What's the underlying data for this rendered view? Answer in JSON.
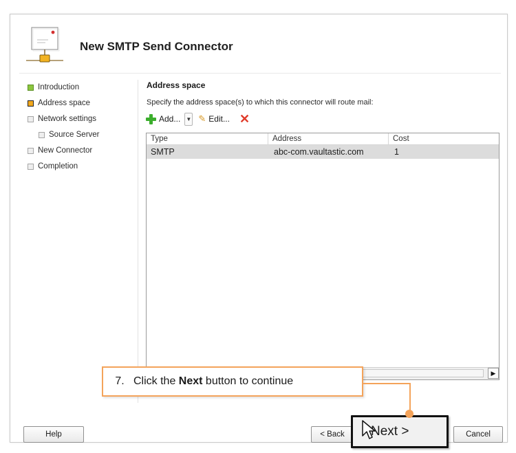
{
  "wizard": {
    "title": "New SMTP Send Connector",
    "icon": "mail-connector-icon"
  },
  "nav": {
    "items": [
      {
        "label": "Introduction",
        "state": "done"
      },
      {
        "label": "Address space",
        "state": "current"
      },
      {
        "label": "Network settings",
        "state": "pending"
      },
      {
        "label": "Source Server",
        "state": "pending",
        "indent": true
      },
      {
        "label": "New Connector",
        "state": "pending"
      },
      {
        "label": "Completion",
        "state": "pending"
      }
    ]
  },
  "main": {
    "section_title": "Address space",
    "description": "Specify the address space(s) to which this connector will route mail:",
    "toolbar": {
      "add_label": "Add...",
      "edit_label": "Edit..."
    },
    "table": {
      "columns": [
        "Type",
        "Address",
        "Cost"
      ],
      "rows": [
        {
          "type": "SMTP",
          "address": "abc-com.vaultastic.com",
          "cost": "1"
        }
      ]
    }
  },
  "callout": {
    "step": "7.",
    "prefix": "Click the ",
    "emphasis": "Next",
    "suffix": " button to continue",
    "color": "#f4a35a"
  },
  "footer": {
    "help_label": "Help",
    "back_label": "< Back",
    "next_label": "Next >",
    "cancel_label": "Cancel"
  },
  "colors": {
    "done": "#8cc63f",
    "current": "#f2a81d",
    "selected_row": "#dcdcdc",
    "add_icon": "#3cae2d",
    "delete_icon": "#e03b2a"
  }
}
